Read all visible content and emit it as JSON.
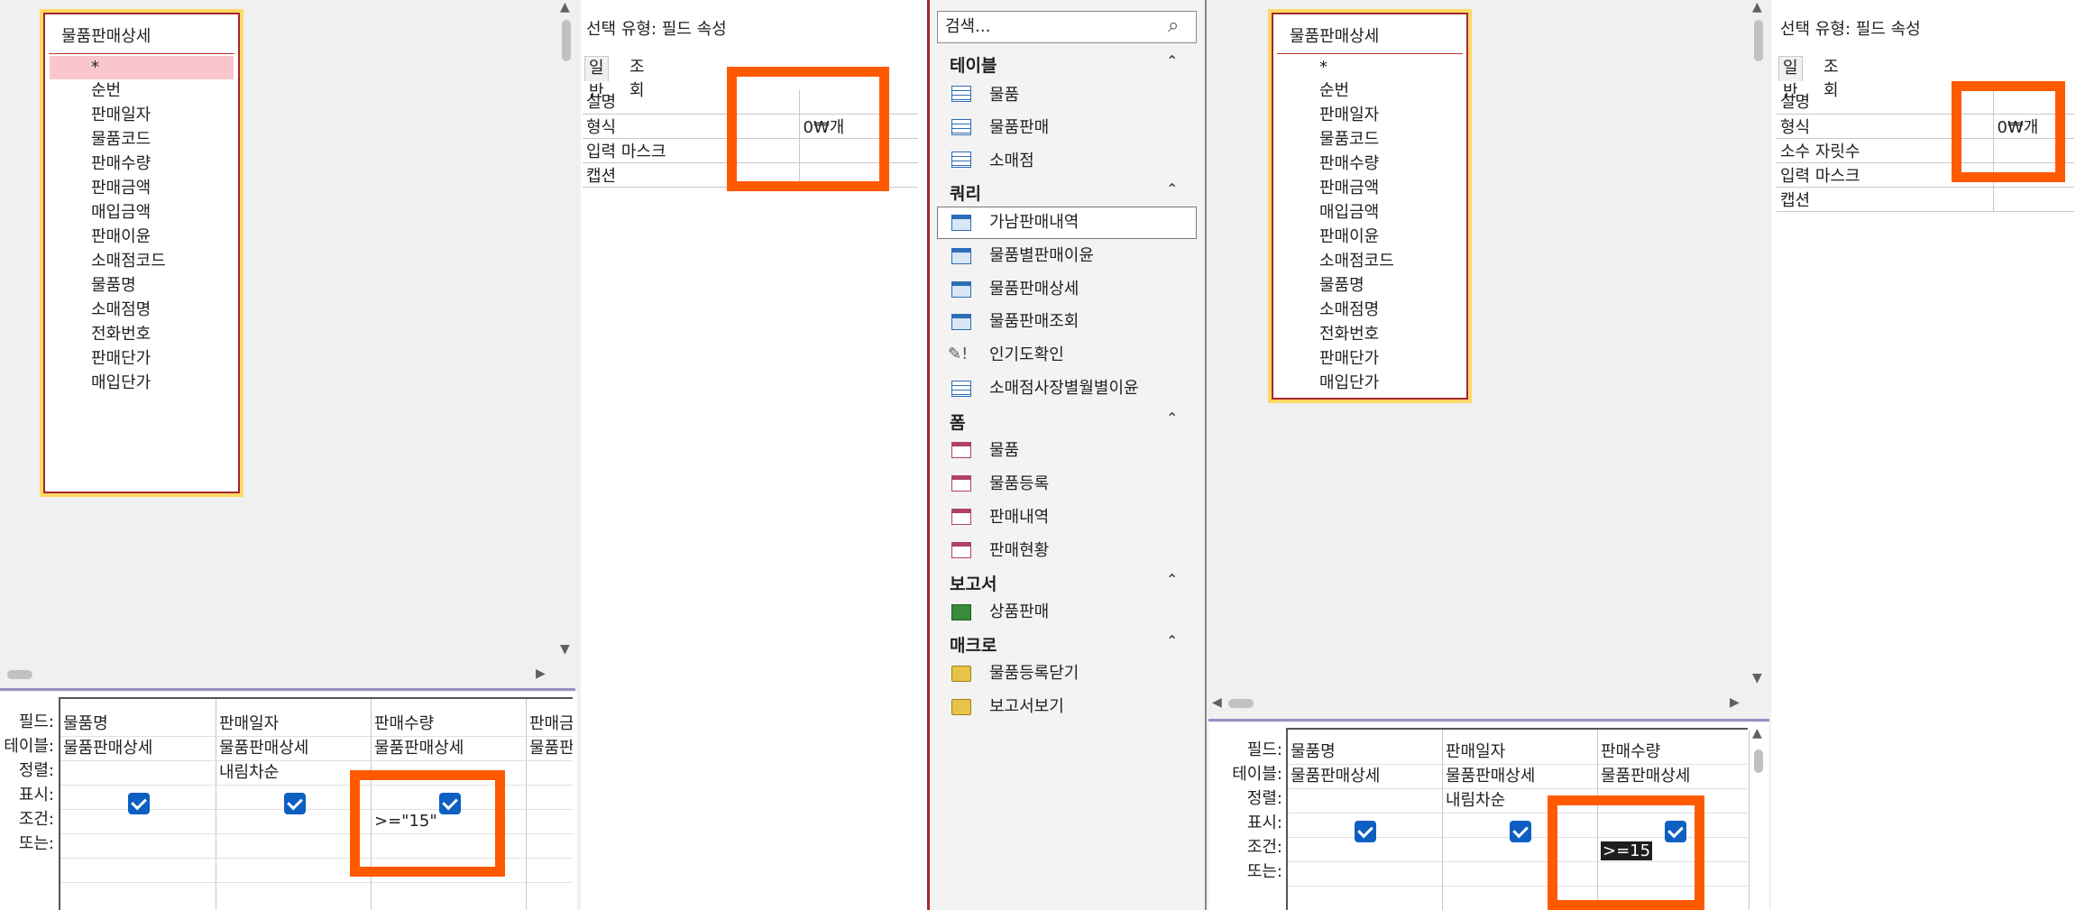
{
  "left_query": {
    "field_list": {
      "title": "물품판매상세",
      "items": [
        "*",
        "순번",
        "판매일자",
        "물품코드",
        "판매수량",
        "판매금액",
        "매입금액",
        "판매이윤",
        "소매점코드",
        "물품명",
        "소매점명",
        "전화번호",
        "판매단가",
        "매입단가"
      ]
    },
    "grid": {
      "row_labels": [
        "필드:",
        "테이블:",
        "정렬:",
        "표시:",
        "조건:",
        "또는:"
      ],
      "columns": [
        {
          "field": "물품명",
          "table": "물품판매상세",
          "sort": "",
          "criteria": ""
        },
        {
          "field": "판매일자",
          "table": "물품판매상세",
          "sort": "내림차순",
          "criteria": ""
        },
        {
          "field": "판매수량",
          "table": "물품판매상세",
          "sort": "",
          "criteria": ">=\"15\""
        },
        {
          "field": "판매금",
          "table": "물품판",
          "sort": "",
          "criteria": ""
        }
      ]
    },
    "property_sheet": {
      "selection_type": "선택 유형: 필드 속성",
      "tabs": [
        "일반",
        "조회"
      ],
      "rows": [
        {
          "name": "설명",
          "value": ""
        },
        {
          "name": "형식",
          "value": "0₩개"
        },
        {
          "name": "입력 마스크",
          "value": ""
        },
        {
          "name": "캡션",
          "value": ""
        }
      ]
    }
  },
  "nav_pane": {
    "search_placeholder": "검색...",
    "sections": [
      {
        "title": "테이블",
        "items": [
          {
            "label": "물품",
            "icon": "table-icon"
          },
          {
            "label": "물품판매",
            "icon": "table-icon"
          },
          {
            "label": "소매점",
            "icon": "table-icon"
          }
        ]
      },
      {
        "title": "쿼리",
        "items": [
          {
            "label": "가남판매내역",
            "icon": "query-icon"
          },
          {
            "label": "물품별판매이윤",
            "icon": "query-icon"
          },
          {
            "label": "물품판매상세",
            "icon": "query-icon"
          },
          {
            "label": "물품판매조회",
            "icon": "query-icon"
          },
          {
            "label": "인기도확인",
            "icon": "action-query-icon"
          },
          {
            "label": "소매점사장별월별이윤",
            "icon": "crosstab-query-icon"
          }
        ]
      },
      {
        "title": "폼",
        "items": [
          {
            "label": "물품",
            "icon": "form-icon"
          },
          {
            "label": "물품등록",
            "icon": "form-icon"
          },
          {
            "label": "판매내역",
            "icon": "form-icon"
          },
          {
            "label": "판매현황",
            "icon": "form-icon"
          }
        ]
      },
      {
        "title": "보고서",
        "items": [
          {
            "label": "상품판매",
            "icon": "report-icon"
          }
        ]
      },
      {
        "title": "매크로",
        "items": [
          {
            "label": "물품등록닫기",
            "icon": "macro-icon"
          },
          {
            "label": "보고서보기",
            "icon": "macro-icon"
          }
        ]
      }
    ]
  },
  "right_query": {
    "field_list": {
      "title": "물품판매상세",
      "items": [
        "*",
        "순번",
        "판매일자",
        "물품코드",
        "판매수량",
        "판매금액",
        "매입금액",
        "판매이윤",
        "소매점코드",
        "물품명",
        "소매점명",
        "전화번호",
        "판매단가",
        "매입단가"
      ]
    },
    "grid": {
      "row_labels": [
        "필드:",
        "테이블:",
        "정렬:",
        "표시:",
        "조건:",
        "또는:"
      ],
      "columns": [
        {
          "field": "물품명",
          "table": "물품판매상세",
          "sort": "",
          "criteria": ""
        },
        {
          "field": "판매일자",
          "table": "물품판매상세",
          "sort": "내림차순",
          "criteria": ""
        },
        {
          "field": "판매수량",
          "table": "물품판매상세",
          "sort": "",
          "criteria": ">=15"
        }
      ]
    },
    "property_sheet": {
      "selection_type": "선택 유형: 필드 속성",
      "tabs": [
        "일반",
        "조회"
      ],
      "rows": [
        {
          "name": "설명",
          "value": ""
        },
        {
          "name": "형식",
          "value": "0₩개"
        },
        {
          "name": "소수 자릿수",
          "value": ""
        },
        {
          "name": "입력 마스크",
          "value": ""
        },
        {
          "name": "캡션",
          "value": ""
        }
      ]
    }
  },
  "colors": {
    "highlight": "#ff5a00",
    "accent": "#a4262c",
    "checkbox": "#0e5fc2"
  }
}
